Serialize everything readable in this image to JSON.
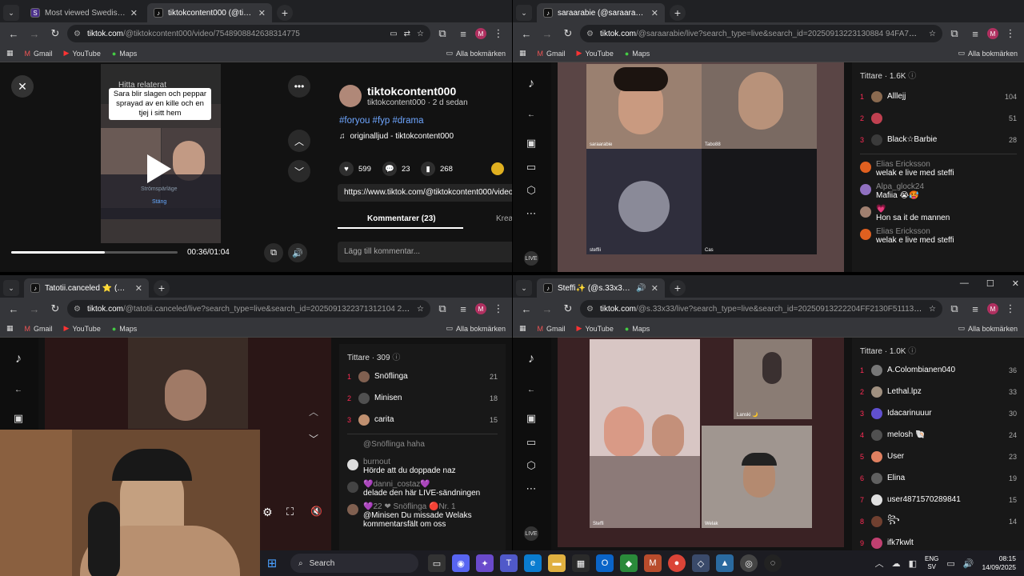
{
  "win1": {
    "tabs": [
      "Most viewed Swedish Kick Stre…",
      "tiktokcontent000 (@tiktokco…"
    ],
    "url_host": "tiktok.com",
    "url_path": "/@tiktokcontent000/video/7548908842638314775",
    "bookmarks": [
      "Gmail",
      "YouTube",
      "Maps"
    ],
    "all_bookmarks": "Alla bokmärken",
    "video_search_hint": "Hitta relaterat",
    "caption": "Sara blir slagen och peppar sprayad av en kille och en tjej i sitt hem",
    "overlay_text1": "Strömspärläge",
    "overlay_text2": "Stäng",
    "time": "00:36/01:04",
    "progress": 0.5625,
    "author": "tiktokcontent000",
    "author_meta": "tiktokcontent000 · 2 d sedan",
    "hashtags": "#foryou #fyp #drama",
    "sound": "originalljud - tiktokcontent000",
    "likes": "599",
    "comments": "23",
    "saves": "268",
    "share_url": "https://www.tiktok.com/@tiktokcontent000/video/",
    "tab_comments": "Kommentarer (23)",
    "tab_creators": "Krea",
    "add_comment": "Lägg till kommentar..."
  },
  "win2": {
    "tab": "saraarabie (@saraarabie) är LIVE",
    "url_host": "tiktok.com",
    "url_path": "/@saraarabie/live?search_type=live&search_id=20250913223130884 94FA7C3DEF…",
    "cam_labels": [
      "saraarabie",
      "Tabo88",
      "steffii",
      "Cas"
    ],
    "viewers_title": "Tittare · 1.6K",
    "viewers": [
      {
        "rank": "1",
        "name": "Alllejj",
        "count": "104",
        "color": "#8a6a50"
      },
      {
        "rank": "2",
        "name": "",
        "count": "51",
        "color": "#c04050"
      },
      {
        "rank": "3",
        "name": "Black☆Barbie",
        "count": "28",
        "color": "#3a3a3a"
      }
    ],
    "comments": [
      {
        "user": "Elias Ericksson",
        "text": "welak e live med steffi",
        "color": "#e06020"
      },
      {
        "user": "Alpa_glock24",
        "text": "Mafiia 😭🥵",
        "color": "#9070c0"
      },
      {
        "user": "💗",
        "text": "Hon sa it de mannen",
        "color": "#a08070"
      },
      {
        "user": "Elias Ericksson",
        "text": "welak e live med steffi",
        "color": "#e06020"
      }
    ]
  },
  "win3": {
    "tab": "Tatotii.canceled ⭐ (@tatotii…",
    "url_host": "tiktok.com",
    "url_path": "/@tatotii.canceled/live?search_type=live&search_id=2025091322371312104 22A6…",
    "viewers_title": "Tittare · 309",
    "viewers": [
      {
        "rank": "1",
        "name": "Snöflinga",
        "count": "21",
        "color": "#806050"
      },
      {
        "rank": "2",
        "name": "Minisen",
        "count": "18",
        "color": "#505050"
      },
      {
        "rank": "3",
        "name": "carita",
        "count": "15",
        "color": "#c09070"
      }
    ],
    "comments": [
      {
        "user": "@Snöflinga haha",
        "text": "",
        "color": ""
      },
      {
        "user": "burnout",
        "text": "Hörde att du doppade naz",
        "color": "#dddddd"
      },
      {
        "user": "💜danni_costaz💜",
        "text": "delade den här LIVE-sändningen",
        "color": "#444444"
      },
      {
        "user": "💜22 ❤ Snöflinga 🔴Nr. 1",
        "text": "@Minisen Du missade Welaks kommentarsfält om oss",
        "color": "#806050"
      }
    ]
  },
  "win4": {
    "tab": "Steffi✨ (@s.33x33) är LIVE",
    "url_host": "tiktok.com",
    "url_path": "/@s.33x33/live?search_type=live&search_id=20250913222204FF2130F51113C796…",
    "cam_labels": [
      "Steffi",
      "Lanski 🌙",
      "Welak"
    ],
    "viewers_title": "Tittare · 1.0K",
    "viewers": [
      {
        "rank": "1",
        "name": "A.Colombianen040",
        "count": "36",
        "color": "#777777"
      },
      {
        "rank": "2",
        "name": "Lethal.lpz",
        "count": "33",
        "color": "#a09080"
      },
      {
        "rank": "3",
        "name": "Idacarinuuur",
        "count": "30",
        "color": "#6050d0"
      },
      {
        "rank": "4",
        "name": "melosh 🐚",
        "count": "24",
        "color": "#505050"
      },
      {
        "rank": "5",
        "name": "User",
        "count": "23",
        "color": "#e08060"
      },
      {
        "rank": "6",
        "name": "Elina",
        "count": "19",
        "color": "#606060"
      },
      {
        "rank": "7",
        "name": "user4871570289841",
        "count": "15",
        "color": "#e0e0e0"
      },
      {
        "rank": "8",
        "name": "꧂",
        "count": "14",
        "color": "#704030"
      },
      {
        "rank": "9",
        "name": "ifk7kwlt",
        "count": "",
        "color": "#c04070"
      }
    ]
  },
  "taskbar": {
    "search": "Search",
    "lang1": "ENG",
    "lang2": "SV",
    "time": "08:15",
    "date": "14/09/2025"
  }
}
